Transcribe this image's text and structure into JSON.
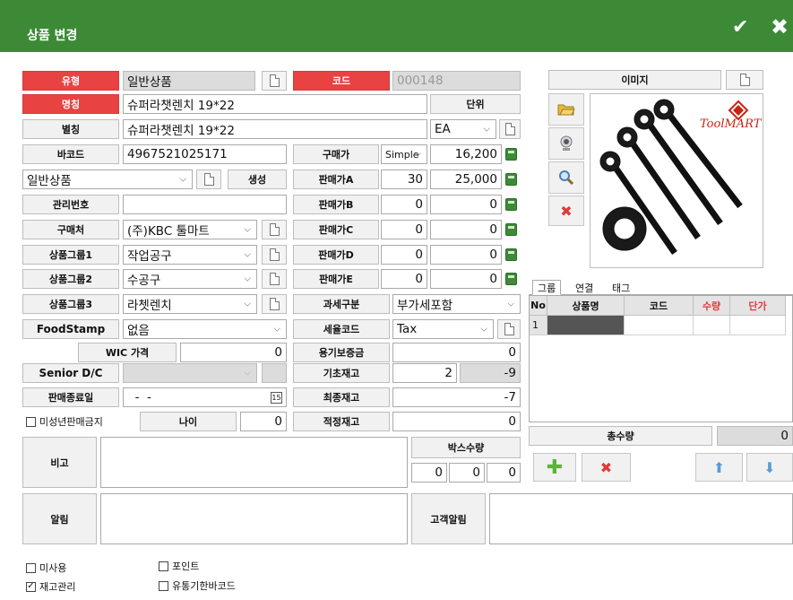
{
  "window": {
    "title": "상품 변경"
  },
  "colors": {
    "titlebar": "#3c8a36",
    "required_label": "#e84242",
    "calc_button": "#3d8a37"
  },
  "icons": [
    "check-icon",
    "close-icon",
    "document-icon",
    "calculator-icon",
    "folder-open-icon",
    "webcam-icon",
    "zoom-icon",
    "delete-icon",
    "add-icon",
    "arrow-up-icon",
    "arrow-down-icon",
    "calendar-icon",
    "chevron-down-icon"
  ],
  "labels": {
    "type": "유형",
    "name": "명칭",
    "alias": "별칭",
    "barcode": "바코드",
    "generate": "생성",
    "manage_no": "관리번호",
    "vendor": "구매처",
    "group1": "상품그룹1",
    "group2": "상품그룹2",
    "group3": "상품그룹3",
    "foodstamp": "FoodStamp",
    "wic_price": "WIC 가격",
    "senior_dc": "Senior D/C",
    "sale_end": "판매종료일",
    "minor_ban": "미성년판매금지",
    "age": "나이",
    "memo": "비고",
    "notice": "알림",
    "customer_notice": "고객알림",
    "code": "코드",
    "unit": "단위",
    "purchase_price": "구매가",
    "price_a": "판매가A",
    "price_b": "판매가B",
    "price_c": "판매가C",
    "price_d": "판매가D",
    "price_e": "판매가E",
    "tax_type": "과세구분",
    "tax_code": "세율코드",
    "deposit": "용기보증금",
    "base_stock": "기초재고",
    "final_stock": "최종재고",
    "proper_stock": "적정재고",
    "box_qty": "박스수량",
    "image": "이미지",
    "total_qty": "총수량"
  },
  "values": {
    "type": "일반상품",
    "code": "000148",
    "name": "슈퍼라챗렌치 19*22",
    "alias": "슈퍼라챗렌치 19*22",
    "unit": "EA",
    "barcode": "4967521025171",
    "purchase_mode": "Simple",
    "purchase_price": "16,200",
    "category": "일반상품",
    "price_a_qty": "30",
    "price_a": "25,000",
    "price_b_qty": "0",
    "price_b": "0",
    "price_c_qty": "0",
    "price_c": "0",
    "price_d_qty": "0",
    "price_d": "0",
    "price_e_qty": "0",
    "price_e": "0",
    "manage_no": "",
    "vendor": "(주)KBC 툴마트",
    "group1": "작업공구",
    "group2": "수공구",
    "group3": "라쳇렌치",
    "tax_type": "부가세포함",
    "tax_code": "Tax",
    "foodstamp": "없음",
    "wic_price": "0",
    "deposit": "0",
    "senior_dc": "",
    "base_stock": "2",
    "base_stock_diff": "-9",
    "sale_end": "  -  -",
    "final_stock": "-7",
    "age": "0",
    "proper_stock": "0",
    "box_qty": [
      "0",
      "0",
      "0"
    ],
    "total_qty": "0"
  },
  "tabs": [
    {
      "label": "그룹",
      "active": true
    },
    {
      "label": "연결",
      "active": false
    },
    {
      "label": "태그",
      "active": false
    }
  ],
  "grid": {
    "columns": [
      "No",
      "상품명",
      "코드",
      "수량",
      "단가"
    ],
    "rows": [
      {
        "no": "1",
        "name": "",
        "code": "",
        "qty": "",
        "price": ""
      }
    ]
  },
  "checkboxes": {
    "unused": {
      "label": "미사용",
      "checked": false
    },
    "stock_manage": {
      "label": "재고관리",
      "checked": true
    },
    "point": {
      "label": "포인트",
      "checked": false
    },
    "expiry_barcode": {
      "label": "유통기한바코드",
      "checked": false
    }
  },
  "brand_logo": "ToolMART"
}
